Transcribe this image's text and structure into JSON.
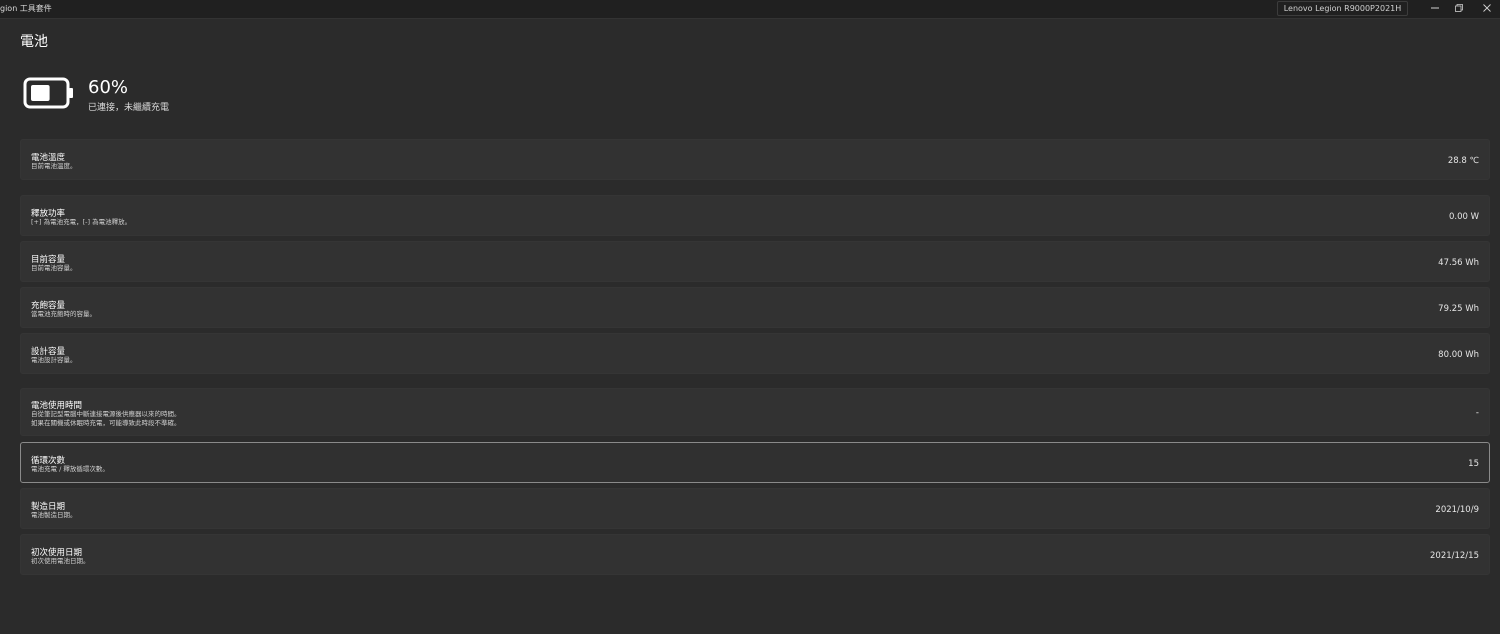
{
  "window": {
    "title": "gion 工具套件",
    "device": "Lenovo Legion R9000P2021H",
    "buttons": {
      "minimize": "minimize",
      "restore": "restore",
      "close": "close"
    }
  },
  "page": {
    "title": "電池",
    "battery": {
      "percent": "60%",
      "level_fraction": 0.6,
      "status": "已連接，未繼續充電"
    }
  },
  "cards": [
    {
      "title": "電池溫度",
      "desc": [
        "目前電池溫度。"
      ],
      "value": "28.8 ℃"
    },
    {
      "title": "釋放功率",
      "desc": [
        "[+] 為電池充電，[-] 為電池釋放。"
      ],
      "value": "0.00 W"
    },
    {
      "title": "目前容量",
      "desc": [
        "目前電池容量。"
      ],
      "value": "47.56 Wh"
    },
    {
      "title": "充飽容量",
      "desc": [
        "當電池充飽時的容量。"
      ],
      "value": "79.25 Wh"
    },
    {
      "title": "設計容量",
      "desc": [
        "電池設計容量。"
      ],
      "value": "80.00 Wh"
    },
    {
      "title": "電池使用時間",
      "desc": [
        "自從筆記型電腦中斷連接電源後供應器以來的時間。",
        "如果在關機或休眠時充電，可能導致此時段不準確。"
      ],
      "value": "-"
    },
    {
      "title": "循環次數",
      "desc": [
        "電池充電 / 釋放循環次數。"
      ],
      "value": "15"
    },
    {
      "title": "製造日期",
      "desc": [
        "電池製造日期。"
      ],
      "value": "2021/10/9"
    },
    {
      "title": "初次使用日期",
      "desc": [
        "初次使用電池日期。"
      ],
      "value": "2021/12/15"
    }
  ],
  "colors": {
    "background": "#2b2b2b",
    "card": "#323232",
    "active_border": "#8a8a8a"
  },
  "icons": {
    "battery": "battery-icon",
    "minimize": "minimize-icon",
    "restore": "restore-icon",
    "close": "close-icon"
  }
}
